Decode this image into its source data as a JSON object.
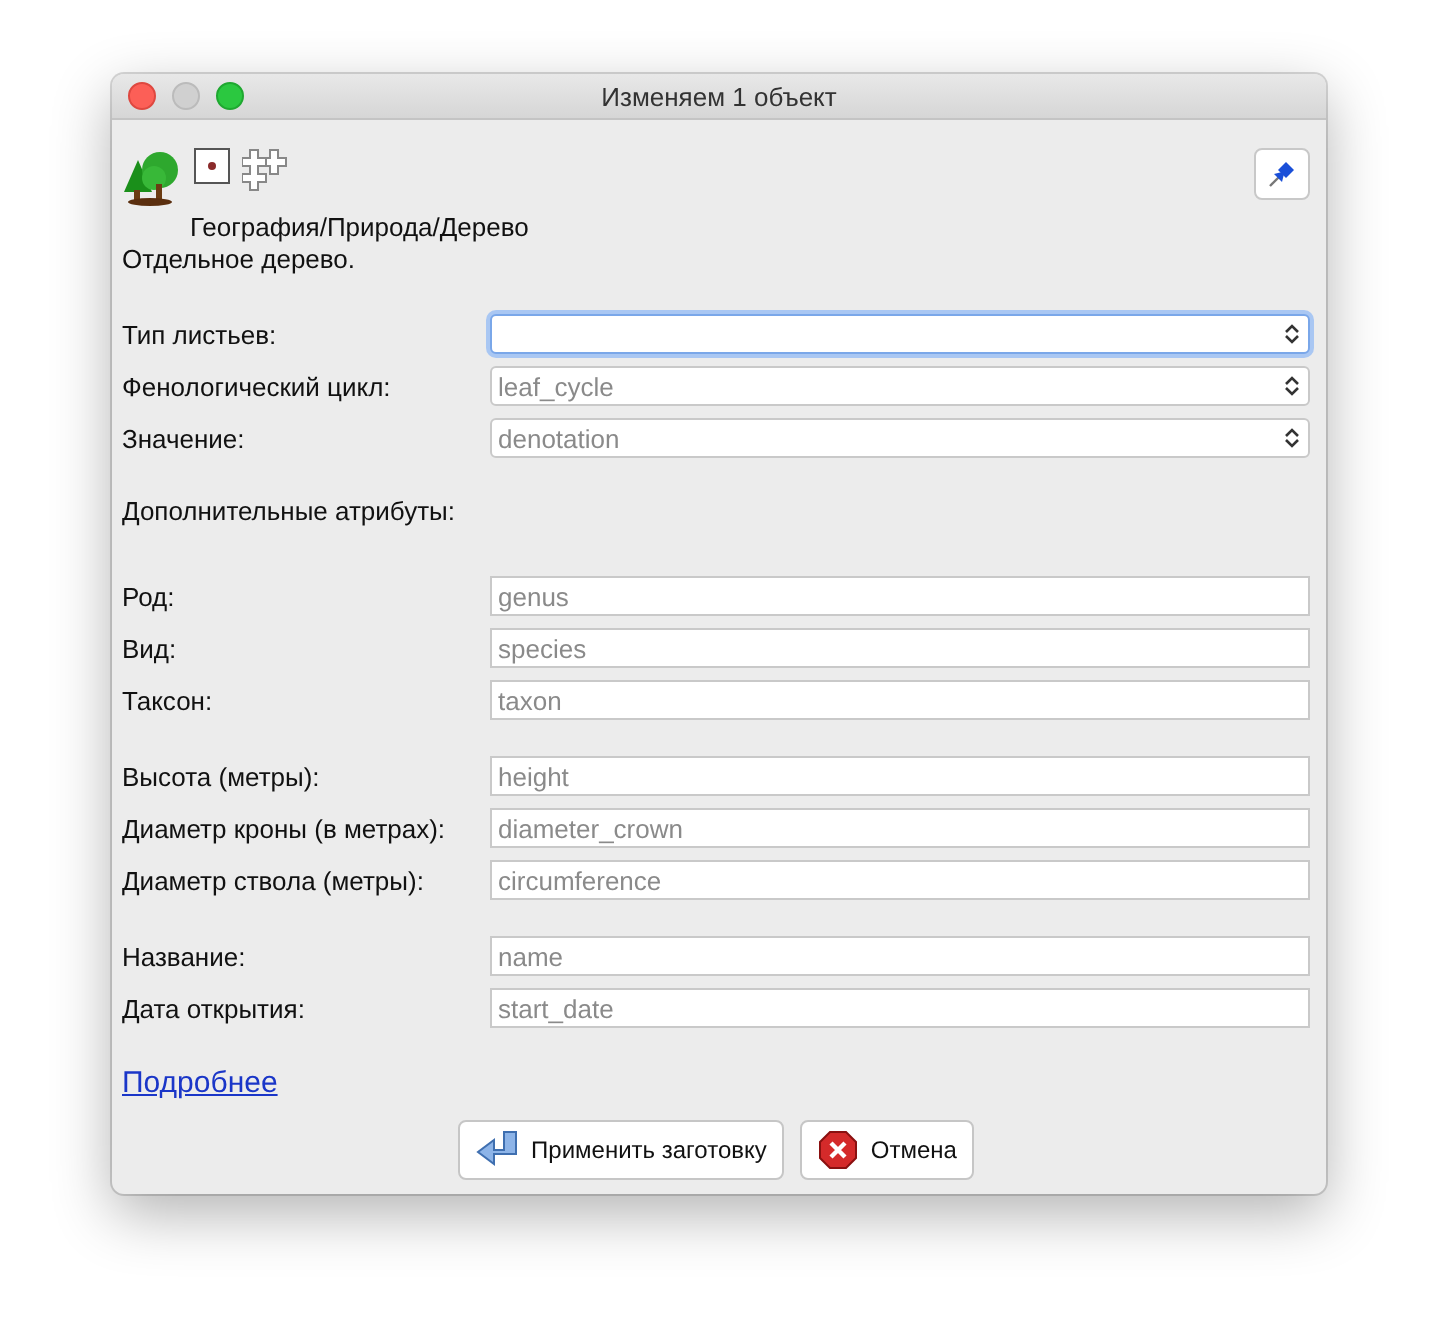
{
  "window": {
    "title": "Изменяем 1 объект"
  },
  "preset": {
    "path": "География/Природа/Дерево",
    "description": "Отдельное дерево."
  },
  "groups": [
    {
      "fields": [
        {
          "label": "Тип листьев:",
          "kind": "combo",
          "focused": true
        },
        {
          "label": "Фенологический цикл:",
          "kind": "combo",
          "placeholder": "leaf_cycle",
          "focused": false
        },
        {
          "label": "Значение:",
          "kind": "combo",
          "placeholder": "denotation",
          "focused": false
        }
      ]
    },
    {
      "heading": "Дополнительные атрибуты:"
    },
    {
      "fields": [
        {
          "label": "Род:",
          "kind": "text",
          "placeholder": "genus",
          "focused": false
        },
        {
          "label": "Вид:",
          "kind": "text",
          "placeholder": "species",
          "focused": false
        },
        {
          "label": "Таксон:",
          "kind": "text",
          "placeholder": "taxon",
          "focused": false
        }
      ]
    },
    {
      "fields": [
        {
          "label": "Высота (метры):",
          "kind": "text",
          "placeholder": "height",
          "focused": false
        },
        {
          "label": "Диаметр кроны (в метрах):",
          "kind": "text",
          "placeholder": "diameter_crown",
          "focused": false
        },
        {
          "label": "Диаметр ствола (метры):",
          "kind": "text",
          "placeholder": "circumference",
          "focused": false
        }
      ]
    },
    {
      "fields": [
        {
          "label": "Название:",
          "kind": "text",
          "placeholder": "name",
          "focused": false
        },
        {
          "label": "Дата открытия:",
          "kind": "text",
          "placeholder": "start_date",
          "focused": false
        }
      ]
    }
  ],
  "link": "Подробнее",
  "buttons": [
    {
      "label": "Применить заготовку",
      "kind": "apply"
    },
    {
      "label": "Отмена",
      "kind": "cancel"
    }
  ]
}
